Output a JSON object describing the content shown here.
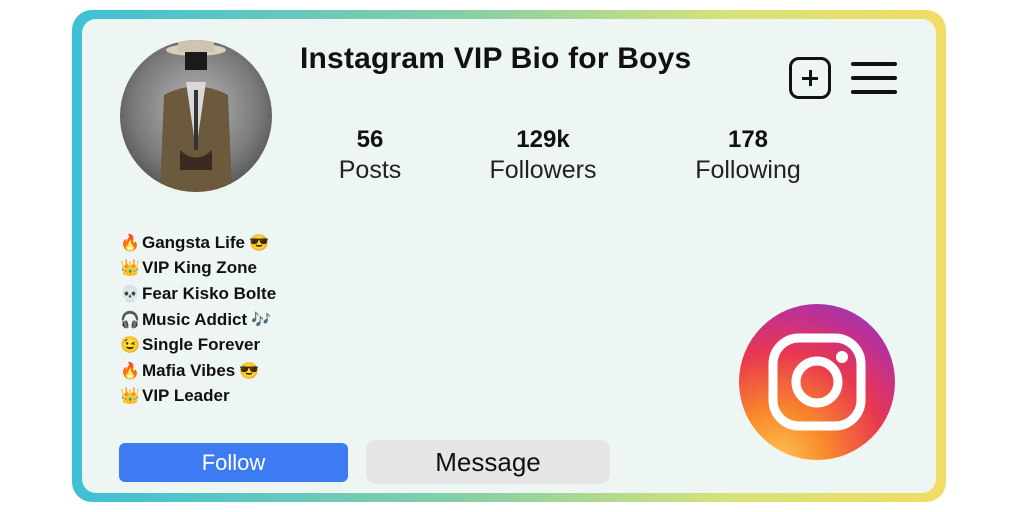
{
  "profile": {
    "title": "Instagram VIP Bio for Boys",
    "stats": [
      {
        "value": "56",
        "label": "Posts"
      },
      {
        "value": "129k",
        "label": "Followers"
      },
      {
        "value": "178",
        "label": "Following"
      }
    ]
  },
  "bio": [
    {
      "icon": "🔥",
      "text": "Gangsta Life",
      "suffix": "😎"
    },
    {
      "icon": "👑",
      "text": "VIP King Zone",
      "suffix": ""
    },
    {
      "icon": "💀",
      "text": "Fear Kisko Bolte",
      "suffix": ""
    },
    {
      "icon": "🎧",
      "text": "Music Addict",
      "suffix": "🎶"
    },
    {
      "icon": "😉",
      "text": "Single Forever",
      "suffix": ""
    },
    {
      "icon": "🔥",
      "text": "Mafia Vibes",
      "suffix": "😎"
    },
    {
      "icon": "👑",
      "text": "VIP Leader",
      "suffix": ""
    }
  ],
  "buttons": {
    "follow": "Follow",
    "message": "Message"
  },
  "icons": {
    "new_post": "plus-square-icon",
    "menu": "hamburger-menu-icon",
    "logo": "instagram-logo-icon"
  },
  "colors": {
    "follow_button": "#3d7bf3",
    "message_button": "#e6e6e6",
    "card_background": "#eef6f3"
  }
}
